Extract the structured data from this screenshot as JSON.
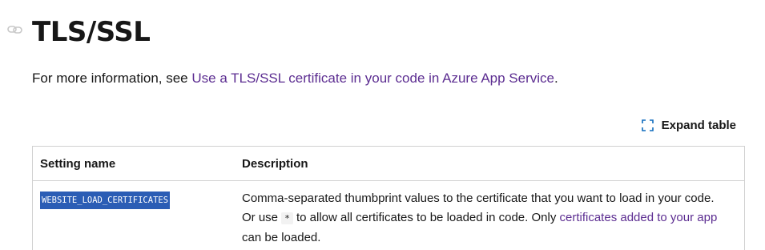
{
  "heading": {
    "title": "TLS/SSL",
    "anchor_icon": "link-icon"
  },
  "intro": {
    "prefix": "For more information, see ",
    "link_text": "Use a TLS/SSL certificate in your code in Azure App Service",
    "suffix": "."
  },
  "expand": {
    "icon": "expand-icon",
    "label": "Expand table"
  },
  "table": {
    "headers": [
      "Setting name",
      "Description"
    ],
    "rows": [
      {
        "setting": "WEBSITE_LOAD_CERTIFICATES",
        "desc_part1": "Comma-separated thumbprint values to the certificate that you want to load in your code. Or use ",
        "inline_code": "*",
        "desc_part2": " to allow all certificates to be loaded in code. Only ",
        "desc_link": "certificates added to your app",
        "desc_part3": " can be loaded."
      }
    ]
  },
  "colors": {
    "link": "#5c2d91",
    "selection": "#2b5db5",
    "border": "#d1d1d1",
    "text": "#171717"
  }
}
